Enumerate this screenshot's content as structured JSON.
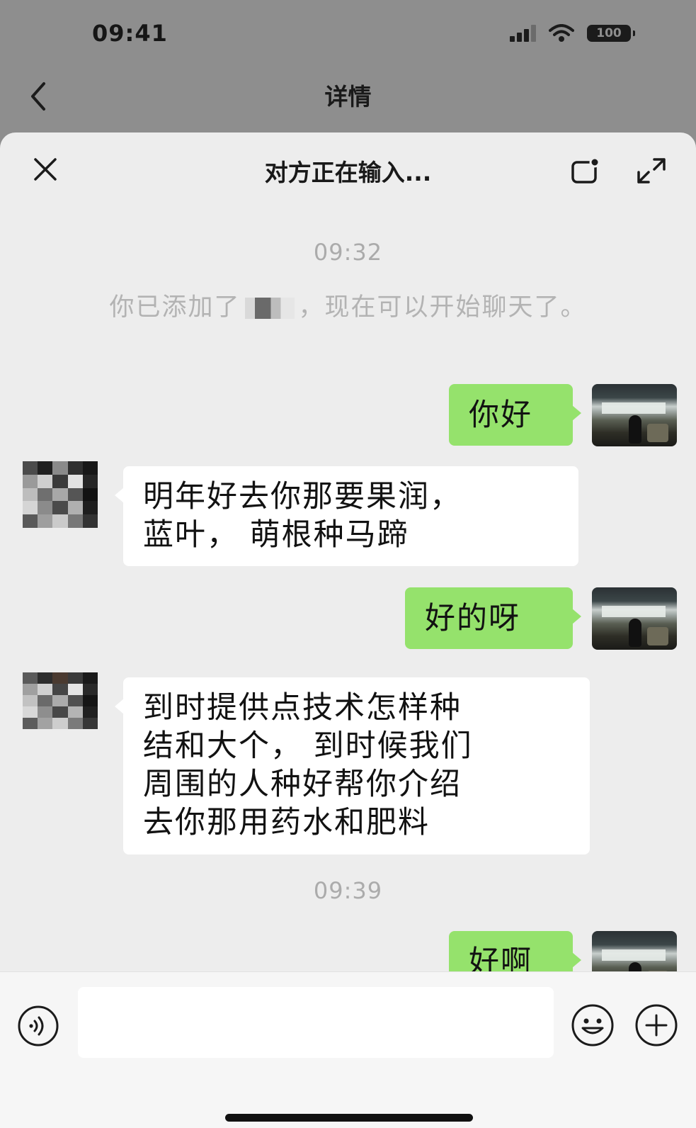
{
  "status_bar": {
    "time": "09:41",
    "battery": "100"
  },
  "nav": {
    "title": "详情"
  },
  "sheet": {
    "title": "对方正在输入..."
  },
  "chat": {
    "time1": "09:32",
    "system_before": "你已添加了",
    "system_after": "，现在可以开始聊天了。",
    "msg1": "你好",
    "msg2_line1": "明年好去你那要果润，",
    "msg2_line2": "蓝叶， 萌根种马蹄",
    "msg3": "好的呀",
    "msg4_line1": "到时提供点技术怎样种",
    "msg4_line2": "结和大个， 到时候我们",
    "msg4_line3": "周围的人种好帮你介绍",
    "msg4_line4": "去你那用药水和肥料",
    "time2": "09:39",
    "msg5": "好啊"
  },
  "input": {
    "value": "",
    "placeholder": ""
  },
  "colors": {
    "sent_bubble": "#95e26c",
    "received_bubble": "#ffffff",
    "chat_bg": "#ededed",
    "dim_overlay": "#8e8e8e"
  },
  "icons": [
    "back-icon",
    "close-icon",
    "floating-window-icon",
    "expand-icon",
    "voice-icon",
    "emoji-icon",
    "plus-icon"
  ]
}
